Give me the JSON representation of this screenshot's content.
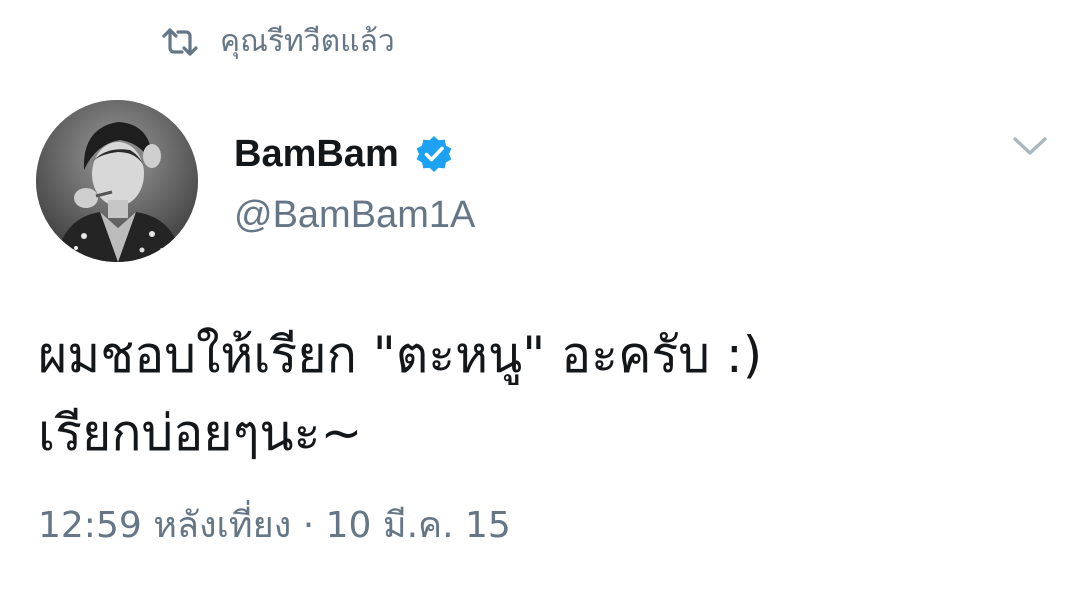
{
  "social_context": {
    "icon": "retweet-icon",
    "label": "คุณรีทวีตแล้ว"
  },
  "author": {
    "avatar": "profile-photo",
    "display_name": "BamBam",
    "verified_icon": "verified-badge-icon",
    "handle": "@BamBam1A"
  },
  "menu_icon": "chevron-down-icon",
  "tweet": {
    "lines": [
      "ผมชอบให้เรียก \"ตะหนู\" อะครับ :)",
      "เรียกบ่อยๆนะ~"
    ]
  },
  "meta": {
    "time": "12:59 หลังเที่ยง",
    "separator": "·",
    "date": "10 มี.ค. 15"
  },
  "colors": {
    "text": "#14171a",
    "muted": "#657786",
    "verified": "#1da1f2",
    "chevron": "#aab8c2"
  }
}
